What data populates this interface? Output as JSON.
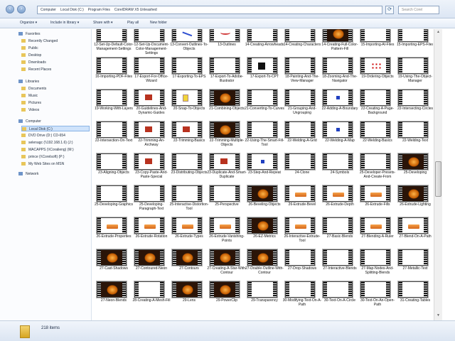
{
  "window": {
    "breadcrumb": [
      "Computer",
      "Local Disk (C:)",
      "Program Files",
      "CorelDRAW X5 Unleashed"
    ],
    "search_placeholder": "Search Corel"
  },
  "toolbar": {
    "organize": "Organize ▾",
    "include": "Include in library ▾",
    "share": "Share with ▾",
    "play": "Play all",
    "newfolder": "New folder"
  },
  "nav": {
    "items": [
      {
        "label": "Favorites",
        "level": 0
      },
      {
        "label": "Recently Changed",
        "level": 1
      },
      {
        "label": "Public",
        "level": 1
      },
      {
        "label": "Desktop",
        "level": 1
      },
      {
        "label": "Downloads",
        "level": 1
      },
      {
        "label": "Recent Places",
        "level": 1
      },
      {
        "label": "Libraries",
        "level": 0
      },
      {
        "label": "Documents",
        "level": 1
      },
      {
        "label": "Music",
        "level": 1
      },
      {
        "label": "Pictures",
        "level": 1
      },
      {
        "label": "Videos",
        "level": 1
      },
      {
        "label": "Computer",
        "level": 0
      },
      {
        "label": "Local Disk (C:)",
        "level": 1,
        "selected": true
      },
      {
        "label": "DVD Drive (D:) CD-654",
        "level": 1
      },
      {
        "label": "selenagc (\\\\192.168.1.6) (J:)",
        "level": 1
      },
      {
        "label": "MACAPPS (\\\\Coralieng) (M:)",
        "level": 1
      },
      {
        "label": "prince (\\\\Corelsoft) (P:)",
        "level": 1
      },
      {
        "label": "My Web Sites on MSN",
        "level": 1
      },
      {
        "label": "Network",
        "level": 0
      }
    ]
  },
  "files": [
    "12-Set-Up-Default-Color-Management-Settings",
    "12-Set-Up-Document-Color-Management-Settings",
    "13-Convert-Outlines-To-Objects",
    "13-Outlines",
    "14-Creating-Arrowheads",
    "14-Creating-Characters",
    "14-Creating-Full-Color-Pattern-Fill",
    "15-Importing-AI-Files",
    "15-Importing-EPS-Files",
    "16-Importing-PDF-Files",
    "17-Export-For-Office-Wizard",
    "17-Exporting-To-EPS",
    "17-Export-To-Adobe-Illustrator",
    "17-Export-To-CPT",
    "18-Painting-And-The-View-Manager",
    "18-Zooming-And-The-Navigator",
    "19-Ordering-Objects",
    "19-Using-The-Object-Manager",
    "19-Working-With-Layers",
    "20-Guidelines-And-Dynamic-Guides",
    "20-Snap-To-Objects",
    "21-Combining-Objects",
    "21-Converting-To-Curves",
    "21-Grouping-And-Ungrouping",
    "22-Adding-A-Boundary",
    "22-Creating-A-Page-Background",
    "22-Intersecting-Circles",
    "22-Intersection-On-Text",
    "22-Trimming-An-Archway",
    "22-Trimming-Basics",
    "22-Trimming-Multiple-Objects",
    "22-Using-The-Smart-Fill-Tool",
    "22-Welding-A-Grid",
    "22-Welding-A-Map",
    "22-Welding-Basics",
    "22-Welding-Text",
    "23-Aligning-Objects",
    "23-Copy-Paste-And-Paste-Special",
    "23-Distributing-Objects",
    "23-Duplicate-And-Smart-Duplicate",
    "23-Step-And-Repeat",
    "24-Clone",
    "24-Symbols",
    "25-Developer-Presets-And-Create-From",
    "25-Developing",
    "25-Developing-Graphics",
    "25-Developing-Paragraph-Text",
    "25-Interactive-Distortion-Tool",
    "25-Perspective",
    "26-Beveling-Objects",
    "26-Extrude-Bevel",
    "26-Extrude-Depth",
    "26-Extrude-Fills",
    "26-Extrude-Lighting",
    "26-Extrude-Properties",
    "26-Extrude-Rotation",
    "26-Extrude-Types",
    "26-Extrude-Vanishing-Points",
    "26-EZ-Metrics",
    "26-Interactive-Extrude-Tool",
    "27-Basic-Blends",
    "27-Blending-A-Ruler",
    "27-Blend-On-A-Path",
    "27-Cast-Shadows",
    "27-Contoured-Neon",
    "27-Contours",
    "27-Creating-A-Star-With-Contour",
    "27-Double-Outline-With-Contour",
    "27-Drop-Shadows",
    "27-Interactive-Blends",
    "27-Map-Nodes-And-Splitting-Blends",
    "27-Metallic-Text",
    "27-Neon-Blends",
    "28-Creating-A-Mesh-Fill",
    "29-Lens",
    "29-PowerClip",
    "29-Transparency",
    "30-Modifying-Text-On-A-Path",
    "30-Text-On-A-Circle",
    "30-Text-On-An-Open-Path",
    "31-Creating-Tables"
  ],
  "thumbs": [
    "plain",
    "plain",
    "blue-stroke",
    "red-curve",
    "plain",
    "plain",
    "dark",
    "plain",
    "plain",
    "plain",
    "plain",
    "plain",
    "plain",
    "black-box",
    "plain",
    "plain",
    "red-dots",
    "plain",
    "plain",
    "red-box",
    "yellow-box",
    "dark",
    "plain",
    "plain",
    "blue-dot",
    "plain",
    "plain",
    "plain",
    "red-box",
    "red-box",
    "dark",
    "plain",
    "plain",
    "blue-dot",
    "plain",
    "plain",
    "plain",
    "red-box",
    "plain",
    "red-box",
    "blue-dot",
    "plain",
    "plain",
    "plain",
    "dark",
    "plain",
    "plain",
    "plain",
    "plain",
    "dark",
    "orange",
    "orange",
    "orange",
    "dark",
    "orange",
    "orange",
    "orange",
    "orange",
    "dark",
    "orange",
    "plain",
    "orange",
    "orange",
    "dark",
    "dark",
    "dark",
    "dark",
    "dark",
    "plain",
    "plain",
    "plain",
    "plain",
    "dark",
    "plain",
    "dark",
    "dark",
    "plain",
    "plain",
    "plain",
    "plain",
    "plain"
  ],
  "status": {
    "count": "218 items"
  },
  "colors": {
    "accent": "#cfe3fb",
    "dark_thumb": "#2a1408"
  }
}
